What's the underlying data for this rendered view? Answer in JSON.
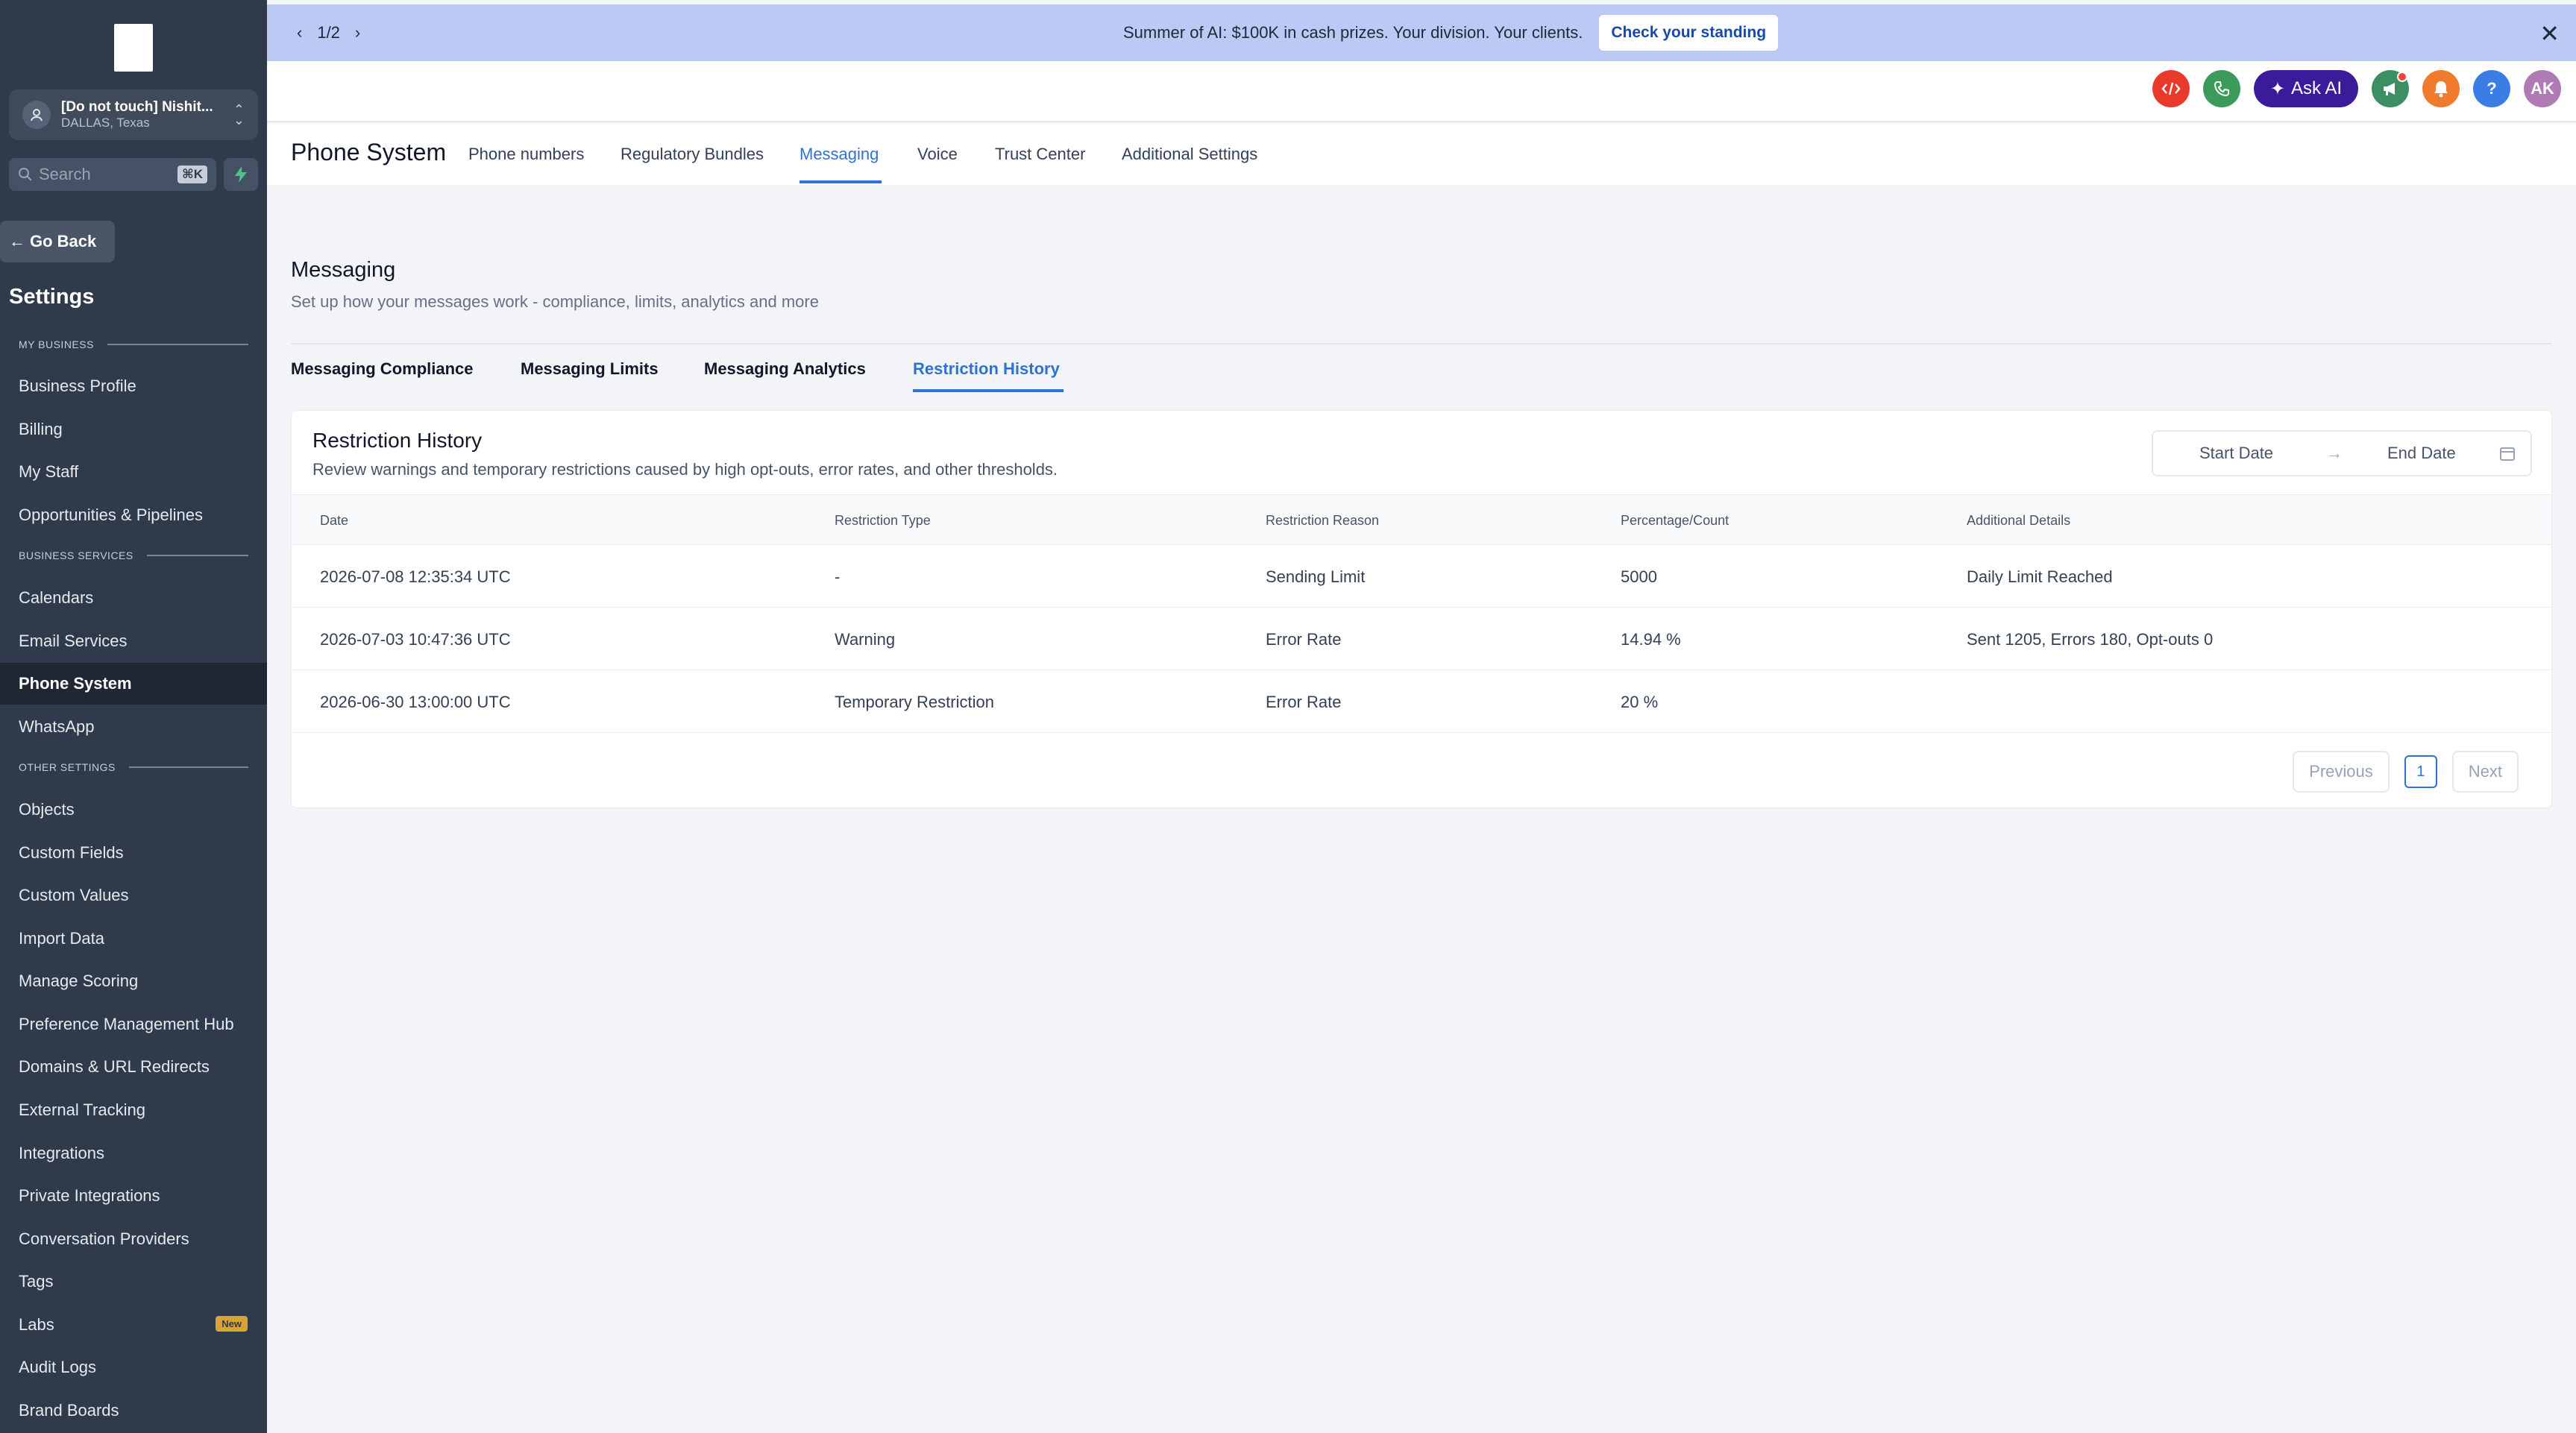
{
  "sidebar": {
    "account": {
      "name": "[Do not touch] Nishit...",
      "location": "DALLAS, Texas"
    },
    "search": {
      "label": "Search",
      "shortcut": "⌘K"
    },
    "go_back": "Go Back",
    "title": "Settings",
    "sections": {
      "my_business": "MY BUSINESS",
      "business_services": "BUSINESS SERVICES",
      "other_settings": "OTHER SETTINGS"
    },
    "items": {
      "business_profile": "Business Profile",
      "billing": "Billing",
      "my_staff": "My Staff",
      "opportunities": "Opportunities & Pipelines",
      "calendars": "Calendars",
      "email_services": "Email Services",
      "phone_system": "Phone System",
      "whatsapp": "WhatsApp",
      "objects": "Objects",
      "custom_fields": "Custom Fields",
      "custom_values": "Custom Values",
      "import_data": "Import Data",
      "manage_scoring": "Manage Scoring",
      "preference_hub": "Preference Management Hub",
      "domains": "Domains & URL Redirects",
      "external_tracking": "External Tracking",
      "integrations": "Integrations",
      "private_integrations": "Private Integrations",
      "conversation_providers": "Conversation Providers",
      "tags": "Tags",
      "labs": "Labs",
      "labs_badge": "New",
      "audit_logs": "Audit Logs",
      "brand_boards": "Brand Boards"
    }
  },
  "banner": {
    "pager": "1/2",
    "text": "Summer of AI: $100K in cash prizes. Your division. Your clients.",
    "cta": "Check your standing"
  },
  "topbar": {
    "ask_ai": "Ask AI",
    "avatar_initials": "AK",
    "help": "?"
  },
  "page": {
    "title": "Phone System",
    "tabs": {
      "phone_numbers": "Phone numbers",
      "regulatory": "Regulatory Bundles",
      "messaging": "Messaging",
      "voice": "Voice",
      "trust_center": "Trust Center",
      "additional": "Additional Settings"
    }
  },
  "messaging": {
    "title": "Messaging",
    "subtitle": "Set up how your messages work - compliance, limits, analytics and more",
    "subtabs": {
      "compliance": "Messaging Compliance",
      "limits": "Messaging Limits",
      "analytics": "Messaging Analytics",
      "history": "Restriction History"
    }
  },
  "card": {
    "title": "Restriction History",
    "subtitle": "Review warnings and temporary restrictions caused by high opt-outs, error rates, and other thresholds.",
    "start_date": "Start Date",
    "end_date": "End Date",
    "columns": {
      "date": "Date",
      "type": "Restriction Type",
      "reason": "Restriction Reason",
      "count": "Percentage/Count",
      "details": "Additional Details"
    },
    "rows": [
      {
        "date": "2026-07-08 12:35:34 UTC",
        "type": "-",
        "reason": "Sending Limit",
        "count": "5000",
        "details": "Daily Limit Reached"
      },
      {
        "date": "2026-07-03 10:47:36 UTC",
        "type": "Warning",
        "reason": "Error Rate",
        "count": "14.94 %",
        "details": "Sent 1205, Errors 180, Opt-outs 0"
      },
      {
        "date": "2026-06-30 13:00:00 UTC",
        "type": "Temporary Restriction",
        "reason": "Error Rate",
        "count": "20 %",
        "details": ""
      }
    ],
    "pagination": {
      "previous": "Previous",
      "page": "1",
      "next": "Next"
    }
  },
  "colors": {
    "accent": "#2e72d2",
    "sidebar": "#2f3a4a",
    "banner": "#bcc9f5"
  }
}
